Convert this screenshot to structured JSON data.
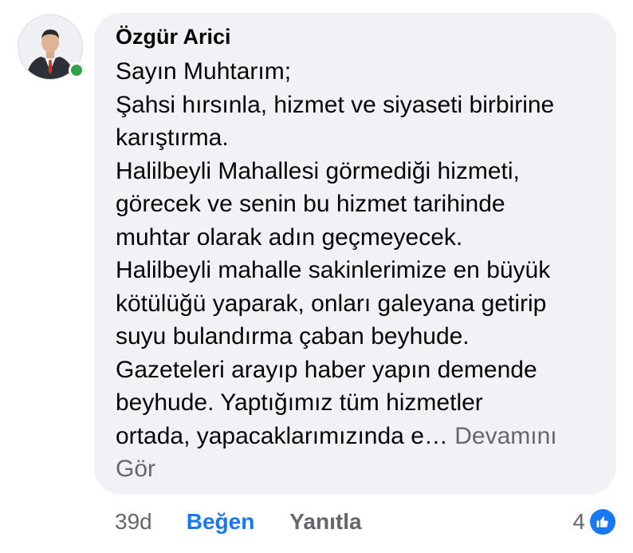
{
  "comment": {
    "author": "Özgür Arici",
    "lines": [
      "Sayın Muhtarım;",
      "Şahsi hırsınla, hizmet ve siyaseti birbirine",
      "karıştırma.",
      "Halilbeyli Mahallesi görmediği hizmeti,",
      "görecek ve senin bu hizmet tarihinde",
      "muhtar olarak adın geçmeyecek.",
      "Halilbeyli mahalle sakinlerimize en büyük",
      "kötülüğü yaparak, onları galeyana getirip",
      "suyu bulandırma çaban beyhude.",
      "Gazeteleri arayıp haber yapın demende",
      "beyhude. Yaptığımız tüm hizmetler"
    ],
    "last_line": "ortada, yapacaklarımızında e…",
    "see_more_part1": "Devamını",
    "see_more_part2": "Gör",
    "online_status_color": "#31a24c"
  },
  "actions": {
    "time": "39d",
    "like_label": "Beğen",
    "reply_label": "Yanıtla"
  },
  "reactions": {
    "count": "4",
    "icon": "thumbs-up-icon",
    "color": "#1877f2"
  }
}
